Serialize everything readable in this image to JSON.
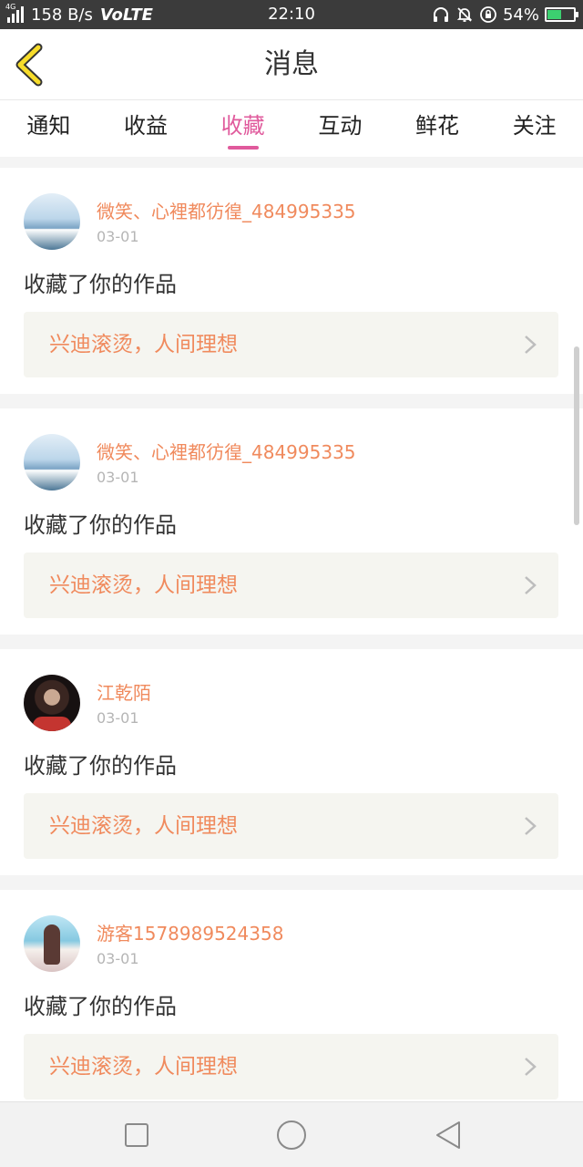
{
  "status_bar": {
    "network_type": "4G",
    "speed": "158 B/s",
    "volte": "VoLTE",
    "time": "22:10",
    "battery_percent": "54%",
    "battery_level": 0.54
  },
  "header": {
    "title": "消息",
    "back_icon": "chevron-left-icon"
  },
  "tabs": [
    {
      "label": "通知",
      "active": false
    },
    {
      "label": "收益",
      "active": false
    },
    {
      "label": "收藏",
      "active": true
    },
    {
      "label": "互动",
      "active": false
    },
    {
      "label": "鲜花",
      "active": false
    },
    {
      "label": "关注",
      "active": false
    }
  ],
  "messages": [
    {
      "username": "微笑、心裡都彷徨_484995335",
      "date": "03-01",
      "action": "收藏了你的作品",
      "work_title": "兴迪滚烫，人间理想"
    },
    {
      "username": "微笑、心裡都彷徨_484995335",
      "date": "03-01",
      "action": "收藏了你的作品",
      "work_title": "兴迪滚烫，人间理想"
    },
    {
      "username": "江乾陌",
      "date": "03-01",
      "action": "收藏了你的作品",
      "work_title": "兴迪滚烫，人间理想"
    },
    {
      "username": "游客1578989524358",
      "date": "03-01",
      "action": "收藏了你的作品",
      "work_title": "兴迪滚烫，人间理想"
    }
  ],
  "colors": {
    "accent": "#e05a9c",
    "username": "#f08a5d",
    "work_title": "#f08a5d"
  }
}
